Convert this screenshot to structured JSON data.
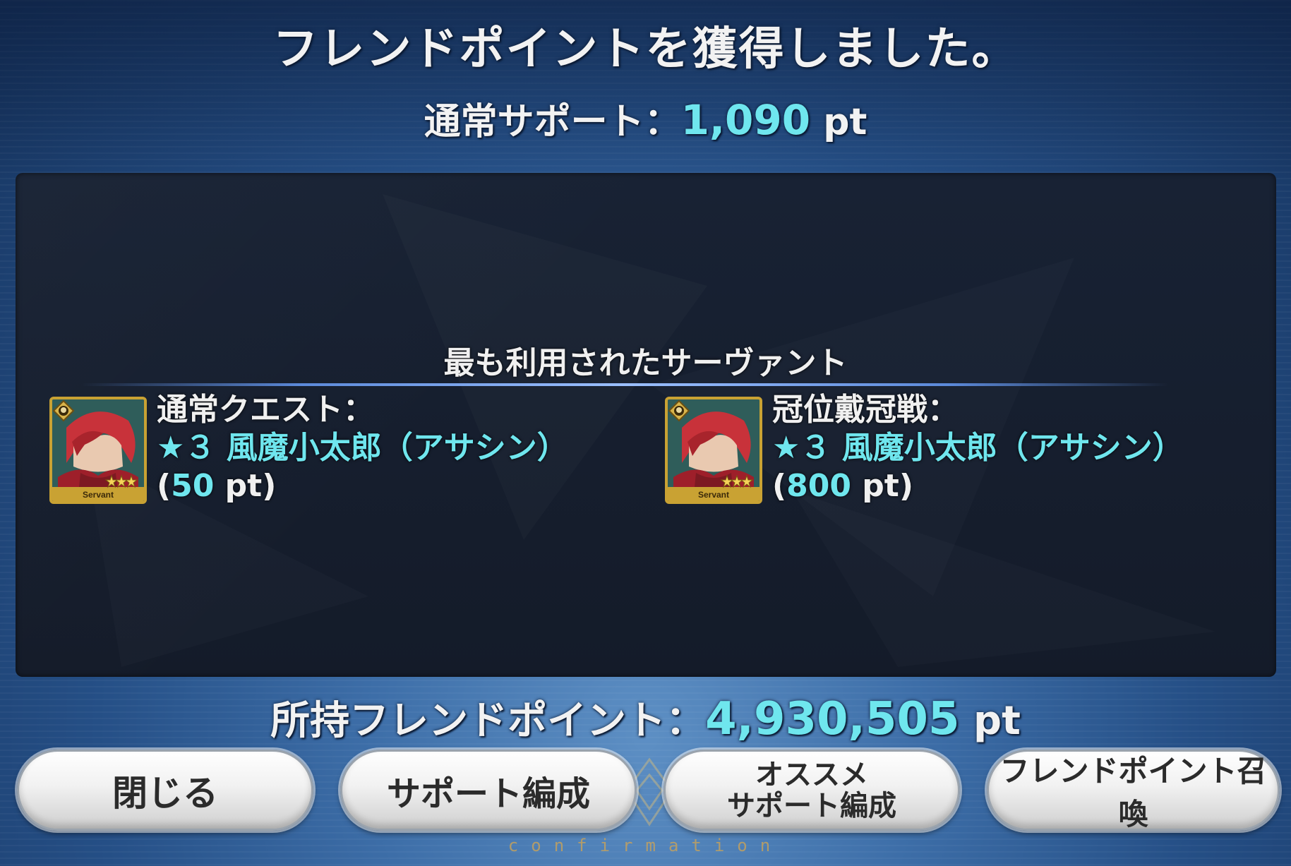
{
  "header": {
    "title": "フレンドポイントを獲得しました。",
    "normal_support_label": "通常サポート：",
    "normal_support_value": "1,090",
    "pt_unit": "pt"
  },
  "most_used": {
    "heading": "最も利用されたサーヴァント",
    "entries": [
      {
        "category": "通常クエスト：",
        "servant": "★３ 風魔小太郎（アサシン）",
        "points_open": "(",
        "points_value": "50",
        "points_close": " pt)",
        "icon_label": "Servant"
      },
      {
        "category": "冠位戴冠戦：",
        "servant": "★３ 風魔小太郎（アサシン）",
        "points_open": "(",
        "points_value": "800",
        "points_close": " pt)",
        "icon_label": "Servant"
      }
    ]
  },
  "owned": {
    "label": "所持フレンドポイント：",
    "value": "4,930,505",
    "unit": "pt"
  },
  "buttons": {
    "close": "閉じる",
    "support_formation": "サポート編成",
    "recommend_line1": "オススメ",
    "recommend_line2": "サポート編成",
    "friend_summon": "フレンドポイント召喚"
  },
  "footer": {
    "text": "confirmation"
  },
  "colors": {
    "accent_cyan": "#6fe6ee",
    "frame_gold": "#c9a233",
    "panel_dark": "#161e2d"
  },
  "icons": {
    "class_icon": "assassin-class-icon",
    "rarity": "three-star-rarity-icon"
  }
}
